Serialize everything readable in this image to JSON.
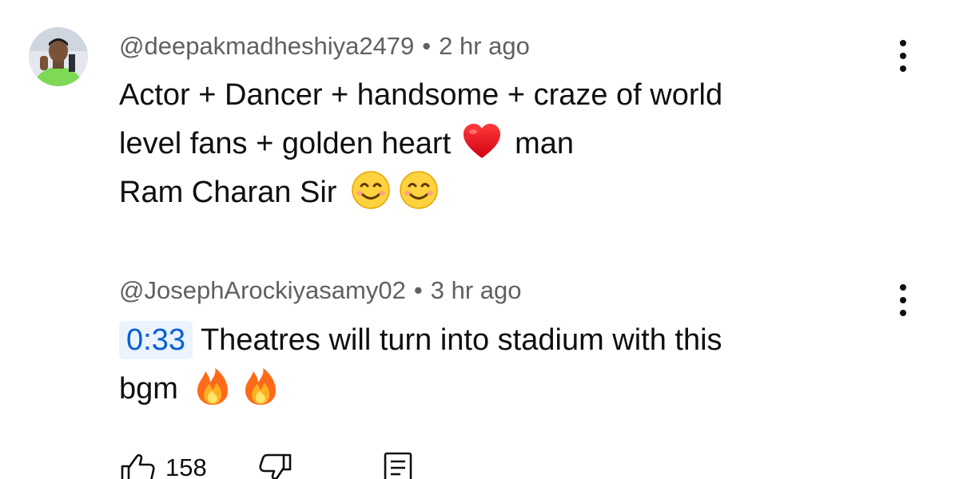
{
  "comments": [
    {
      "author": "@deepakmadheshiya2479",
      "separator": "•",
      "time": "2 hr ago",
      "lines": [
        {
          "text": "Actor + Dancer + handsome + craze of world",
          "emojis": []
        },
        {
          "text": "level fans + golden heart",
          "emojis": [
            "red-heart-emoji"
          ],
          "after": "man"
        },
        {
          "text": "Ram Charan Sir",
          "emojis": [
            "smiling-face-emoji",
            "smiling-face-emoji"
          ]
        }
      ]
    },
    {
      "author": "@JosephArockiyasamy02",
      "separator": "•",
      "time": "3 hr ago",
      "timestamp": "0:33",
      "lines": [
        {
          "text": "Theatres will turn into stadium with this",
          "emojis": []
        },
        {
          "text": "bgm",
          "emojis": [
            "fire-emoji",
            "fire-emoji"
          ]
        }
      ],
      "actions": {
        "like_icon": "thumbs-up-icon",
        "like_count": "158",
        "dislike_icon": "thumbs-down-icon",
        "reply_icon": "comment-icon"
      }
    }
  ],
  "colors": {
    "meta_text": "#606060",
    "timestamp_text": "#065fd4",
    "timestamp_bg": "#eaf3fe"
  }
}
